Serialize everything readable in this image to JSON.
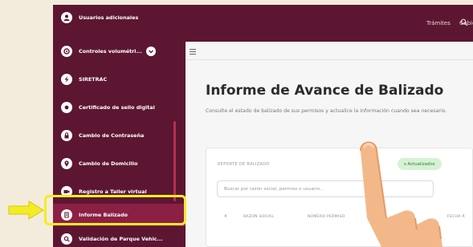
{
  "sidebar": {
    "items": [
      {
        "label": "Usuarios adicionales",
        "icon": "user-icon"
      },
      {
        "label": "Controles volumétri...",
        "icon": "gauge-icon"
      },
      {
        "label": "SIRETRAC",
        "icon": "bolt-icon"
      },
      {
        "label": "Certificado de sello digital",
        "icon": "seal-icon"
      },
      {
        "label": "Cambio de Contraseña",
        "icon": "lock-icon"
      },
      {
        "label": "Cambio de Domicilio",
        "icon": "location-pin-icon"
      },
      {
        "label": "Registro a Taller virtual",
        "icon": "video-icon"
      },
      {
        "label": "Informe Balizado",
        "icon": "report-icon"
      },
      {
        "label": "Validación de Parque Vehic...",
        "icon": "search-icon"
      }
    ],
    "active_item": "Informe Balizado"
  },
  "topbar": {
    "links": [
      "Trámites",
      "Gobierno"
    ]
  },
  "main": {
    "title": "Informe de Avance de Balizado",
    "description": "Consulte el estado de balizado de sus permisos y actualice la información cuando sea necesario.",
    "report": {
      "title": "REPORTE DE BALIZADO",
      "badge": "s Actualizados",
      "search_placeholder": "Buscar por razón social, permiso o usuario...",
      "columns": [
        "#",
        "RAZÓN SOCIAL",
        "NÚMERO PERMISO",
        "FECHA R"
      ]
    }
  },
  "colors": {
    "brand": "#5c1631",
    "active": "#8b1f45",
    "highlight": "#f2ec27",
    "badge_bg": "#d6f2d4"
  }
}
